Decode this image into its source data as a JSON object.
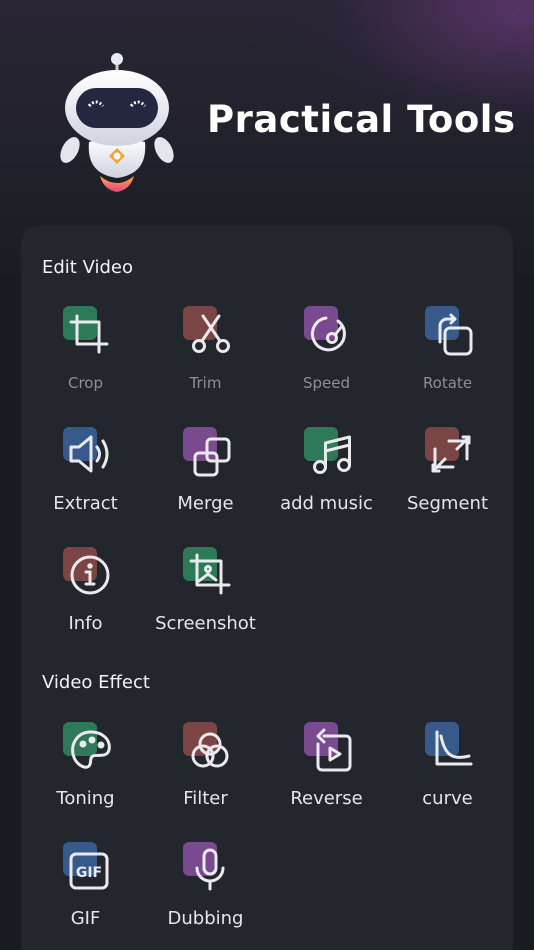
{
  "header": {
    "title": "Practical Tools"
  },
  "colors": {
    "background": "#1b1c23",
    "card": "#24262d",
    "green": "#2e7a58",
    "red": "#7b4545",
    "purple": "#7a4a8e",
    "blue": "#375a8c",
    "icon_stroke": "#e9e9ee"
  },
  "sections": [
    {
      "title": "Edit Video",
      "tools": [
        {
          "label": "Crop",
          "icon": "crop-icon",
          "color": "green"
        },
        {
          "label": "Trim",
          "icon": "scissors-icon",
          "color": "red"
        },
        {
          "label": "Speed",
          "icon": "speed-icon",
          "color": "purple"
        },
        {
          "label": "Rotate",
          "icon": "rotate-icon",
          "color": "blue"
        },
        {
          "label": "Extract",
          "icon": "speaker-icon",
          "color": "blue"
        },
        {
          "label": "Merge",
          "icon": "merge-icon",
          "color": "purple"
        },
        {
          "label": "add music",
          "icon": "music-note-icon",
          "color": "green"
        },
        {
          "label": "Segment",
          "icon": "segment-icon",
          "color": "red"
        },
        {
          "label": "Info",
          "icon": "info-icon",
          "color": "red"
        },
        {
          "label": "Screenshot",
          "icon": "screenshot-icon",
          "color": "green"
        }
      ]
    },
    {
      "title": "Video Effect",
      "tools": [
        {
          "label": "Toning",
          "icon": "palette-icon",
          "color": "green"
        },
        {
          "label": "Filter",
          "icon": "filter-icon",
          "color": "red"
        },
        {
          "label": "Reverse",
          "icon": "reverse-icon",
          "color": "purple"
        },
        {
          "label": "curve",
          "icon": "curve-icon",
          "color": "blue"
        },
        {
          "label": "GIF",
          "icon": "gif-icon",
          "color": "blue"
        },
        {
          "label": "Dubbing",
          "icon": "microphone-icon",
          "color": "purple"
        }
      ]
    }
  ]
}
